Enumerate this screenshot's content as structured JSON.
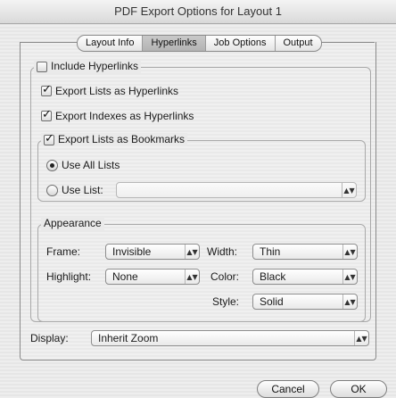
{
  "window": {
    "title": "PDF Export Options for Layout 1"
  },
  "tabs": [
    {
      "label": "Layout Info",
      "active": false
    },
    {
      "label": "Hyperlinks",
      "active": true
    },
    {
      "label": "Job Options",
      "active": false
    },
    {
      "label": "Output",
      "active": false
    }
  ],
  "hyperlinks": {
    "include_label": "Include Hyperlinks",
    "include_checked": false,
    "export_lists_label": "Export Lists as Hyperlinks",
    "export_lists_checked": true,
    "export_indexes_label": "Export Indexes as Hyperlinks",
    "export_indexes_checked": true
  },
  "bookmarks": {
    "label": "Export Lists as Bookmarks",
    "checked": true,
    "use_all_label": "Use All Lists",
    "use_all_selected": true,
    "use_list_label": "Use List:",
    "use_list_selected": false,
    "use_list_value": ""
  },
  "appearance": {
    "title": "Appearance",
    "frame_label": "Frame:",
    "frame_value": "Invisible",
    "highlight_label": "Highlight:",
    "highlight_value": "None",
    "width_label": "Width:",
    "width_value": "Thin",
    "color_label": "Color:",
    "color_value": "Black",
    "style_label": "Style:",
    "style_value": "Solid"
  },
  "display": {
    "label": "Display:",
    "value": "Inherit Zoom"
  },
  "buttons": {
    "cancel": "Cancel",
    "ok": "OK"
  },
  "icons": {
    "select_arrows": "▲▼"
  }
}
